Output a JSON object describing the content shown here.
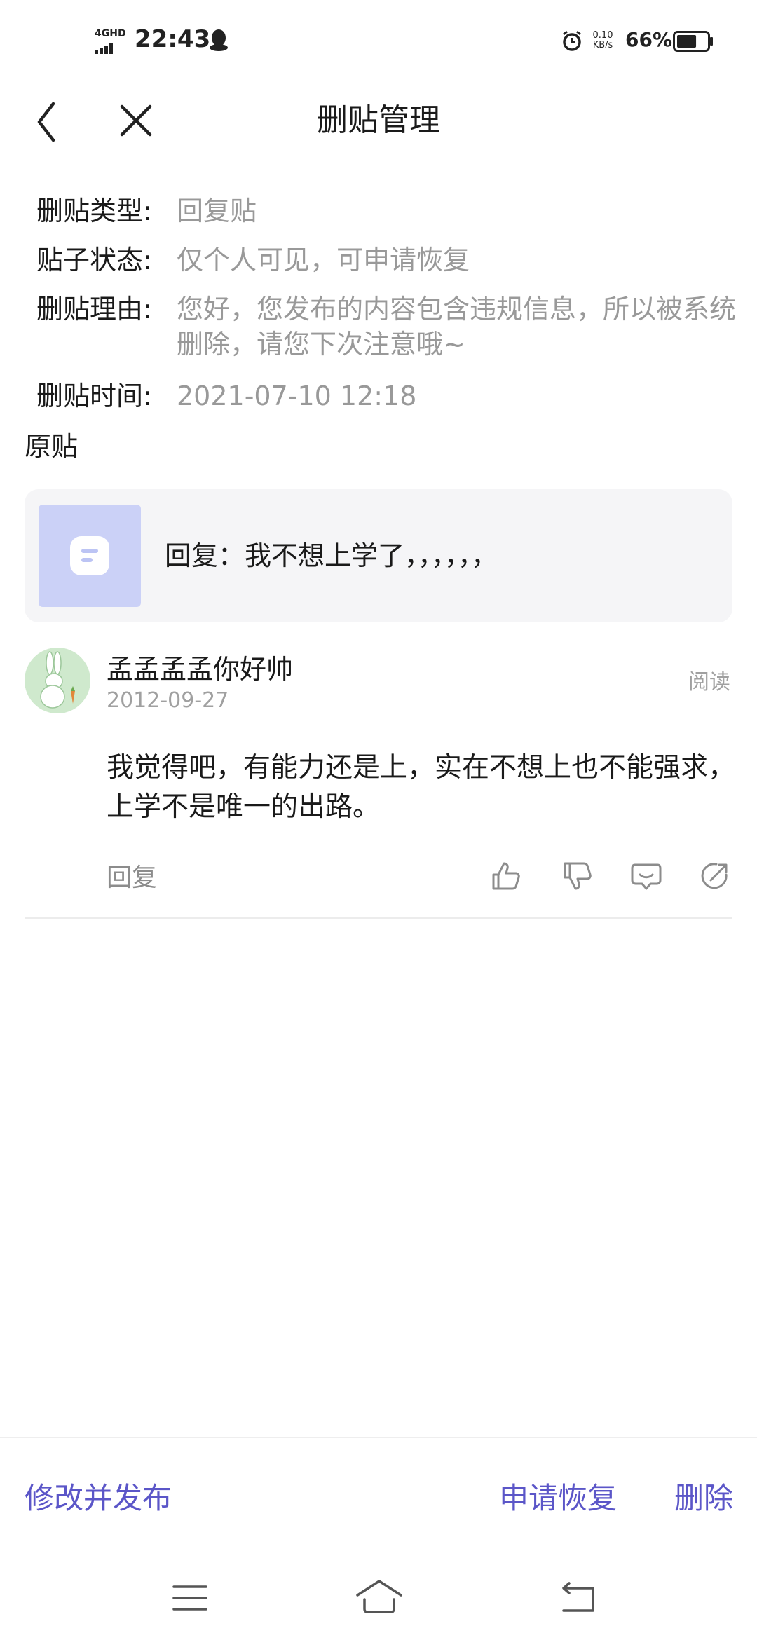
{
  "status_bar": {
    "network": "4GHD",
    "time": "22:43",
    "speed_value": "0.10",
    "speed_unit": "KB/s",
    "battery": "66%",
    "battery_level": 0.66
  },
  "nav": {
    "title": "删贴管理"
  },
  "info": {
    "type_label": "删贴类型:",
    "type_value": "回复贴",
    "status_label": "贴子状态:",
    "status_value": "仅个人可见，可申请恢复",
    "reason_label": "删贴理由:",
    "reason_value": "您好，您发布的内容包含违规信息，所以被系统删除，请您下次注意哦~",
    "time_label": "删贴时间:",
    "time_value": "2021-07-10 12:18"
  },
  "original": {
    "section_title": "原贴",
    "text": "回复：我不想上学了，，，，，，"
  },
  "reply": {
    "author": "孟孟孟孟你好帅",
    "date": "2012-09-27",
    "read_label": "阅读",
    "body": "我觉得吧，有能力还是上，实在不想上也不能强求，上学不是唯一的出路。",
    "reply_label": "回复"
  },
  "bottom": {
    "edit_label": "修改并发布",
    "restore_label": "申请恢复",
    "delete_label": "删除"
  },
  "colors": {
    "accent": "#5b56c8",
    "muted": "#999999",
    "card_bg": "#f5f5f7"
  }
}
